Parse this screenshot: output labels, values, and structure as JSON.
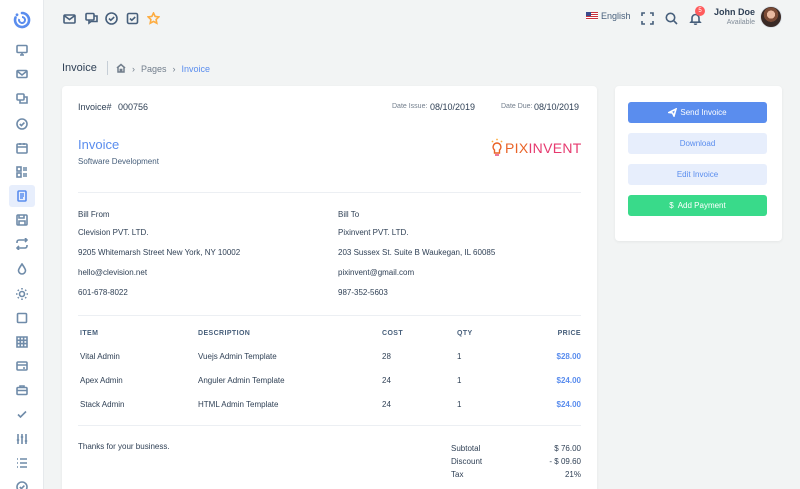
{
  "topnav": {
    "language": "English",
    "notification_count": "5",
    "user_name": "John Doe",
    "user_status": "Available",
    "icons": [
      "mail-icon",
      "chat-icon",
      "check-circle-icon",
      "star-icon",
      "fullscreen-icon",
      "search-icon",
      "bell-icon"
    ]
  },
  "sidebar": {
    "icons": [
      "monitor-icon",
      "mail-icon",
      "chat-icon",
      "check-circle-icon",
      "calendar-icon",
      "kanban-icon",
      "invoice-icon",
      "save-icon",
      "repeat-icon",
      "droplet-icon",
      "sun-icon",
      "square-icon",
      "grid-icon",
      "credit-card-icon",
      "briefcase-icon",
      "check-icon",
      "sliders-icon",
      "list-icon",
      "circle-check-icon"
    ],
    "active": "invoice-icon"
  },
  "breadcrumb": {
    "title": "Invoice",
    "items": [
      "Pages",
      "Invoice"
    ]
  },
  "invoice": {
    "number_label": "Invoice#",
    "number": "000756",
    "date_issue_label": "Date Issue:",
    "date_issue": "08/10/2019",
    "date_due_label": "Date Due:",
    "date_due": "08/10/2019",
    "title": "Invoice",
    "subtitle": "Software Development",
    "brand_part1": "PIX",
    "brand_part2": "INVENT",
    "bill_from": {
      "heading": "Bill From",
      "company": "Clevision PVT. LTD.",
      "address": "9205 Whitemarsh Street New York, NY 10002",
      "email": "hello@clevision.net",
      "phone": "601-678-8022"
    },
    "bill_to": {
      "heading": "Bill To",
      "company": "Pixinvent PVT. LTD.",
      "address": "203 Sussex St. Suite B Waukegan, IL 60085",
      "email": "pixinvent@gmail.com",
      "phone": "987-352-5603"
    },
    "table": {
      "headers": [
        "ITEM",
        "DESCRIPTION",
        "COST",
        "QTY",
        "PRICE"
      ],
      "rows": [
        {
          "item": "Vital Admin",
          "description": "Vuejs Admin Template",
          "cost": "28",
          "qty": "1",
          "price": "$28.00"
        },
        {
          "item": "Apex Admin",
          "description": "Anguler Admin Template",
          "cost": "24",
          "qty": "1",
          "price": "$24.00"
        },
        {
          "item": "Stack Admin",
          "description": "HTML Admin Template",
          "cost": "24",
          "qty": "1",
          "price": "$24.00"
        }
      ]
    },
    "thanks": "Thanks for your business.",
    "summary": {
      "subtotal_label": "Subtotal",
      "subtotal": "$ 76.00",
      "discount_label": "Discount",
      "discount": "- $ 09.60",
      "tax_label": "Tax",
      "tax": "21%"
    }
  },
  "actions": {
    "send": "Send Invoice",
    "download": "Download",
    "edit": "Edit Invoice",
    "payment": "Add Payment"
  },
  "colors": {
    "primary": "#5a8dee",
    "success": "#39da8a",
    "danger": "#ff5b5c",
    "light_primary": "#e7eefc"
  }
}
